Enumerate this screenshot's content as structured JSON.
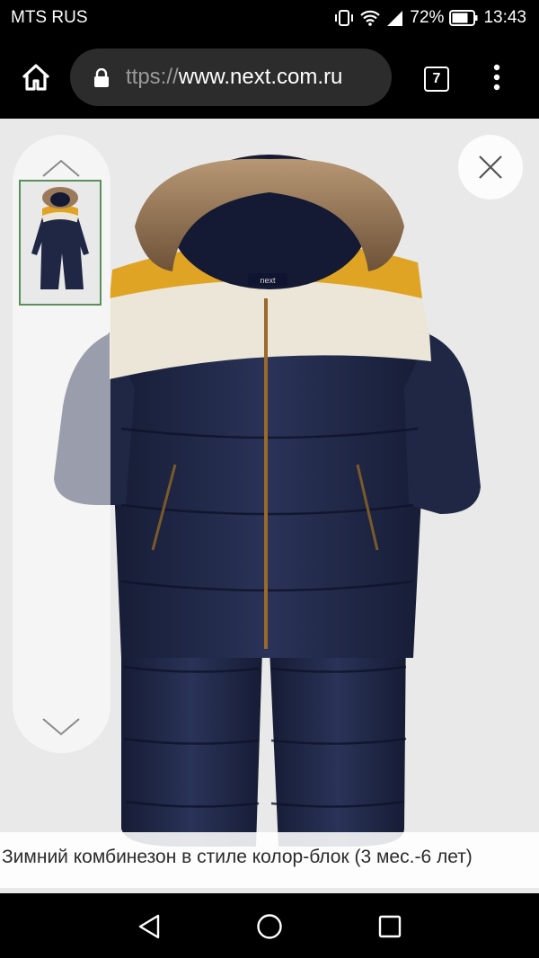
{
  "status_bar": {
    "carrier": "MTS RUS",
    "battery_percent": "72%",
    "time": "13:43",
    "icons": [
      "vibrate-icon",
      "wifi-icon",
      "signal-icon",
      "battery-icon"
    ]
  },
  "browser": {
    "url_scheme": "ttps://",
    "url_host": "www.next.com.ru",
    "tab_count": "7",
    "icons": [
      "home-icon",
      "lock-icon",
      "tabs-icon",
      "overflow-menu-icon"
    ]
  },
  "product": {
    "caption": "Зимний комбинезон в стиле колор-блок (3 мес.-6 лет)",
    "label_on_image": "next",
    "colors": {
      "navy": "#1f2745",
      "mustard": "#e0a425",
      "cream": "#ece6d8",
      "fur": "#9a7a5a"
    }
  },
  "gallery": {
    "icons": [
      "chevron-up-icon",
      "chevron-down-icon",
      "close-icon"
    ],
    "thumbnail_count": 1
  },
  "nav_bar": {
    "icons": [
      "back-icon",
      "home-circle-icon",
      "recents-icon"
    ]
  }
}
